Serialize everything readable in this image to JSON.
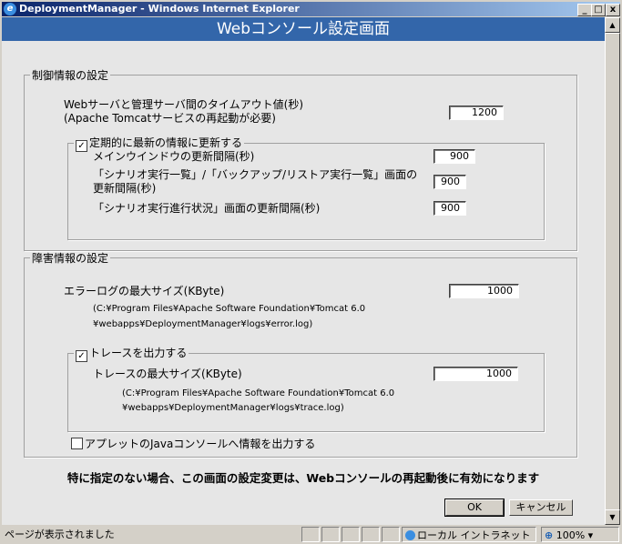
{
  "window": {
    "title": "DeploymentManager - Windows Internet Explorer",
    "ie_icon": "e",
    "minimize": "_",
    "maximize": "□",
    "close": "x"
  },
  "header": {
    "title": "Webコンソール設定画面"
  },
  "control": {
    "legend": "制御情報の設定",
    "timeout_label_1": "Webサーバと管理サーバ間のタイムアウト値(秒)",
    "timeout_label_2": "(Apache Tomcatサービスの再起動が必要)",
    "timeout_value": "1200",
    "refresh_checked": true,
    "refresh_label": "定期的に最新の情報に更新する",
    "main_window_label": "メインウインドウの更新間隔(秒)",
    "main_window_value": "900",
    "scenario_list_label_1": "「シナリオ実行一覧」/「バックアップ/リストア実行一覧」画面の",
    "scenario_list_label_2": "更新間隔(秒)",
    "scenario_list_value": "900",
    "scenario_progress_label": "「シナリオ実行進行状況」画面の更新間隔(秒)",
    "scenario_progress_value": "900"
  },
  "fault": {
    "legend": "障害情報の設定",
    "errorlog_label": "エラーログの最大サイズ(KByte)",
    "errorlog_value": "1000",
    "errorlog_path_1": "(C:¥Program Files¥Apache Software Foundation¥Tomcat 6.0",
    "errorlog_path_2": "¥webapps¥DeploymentManager¥logs¥error.log)",
    "trace_checked": true,
    "trace_label": "トレースを出力する",
    "trace_size_label": "トレースの最大サイズ(KByte)",
    "trace_size_value": "1000",
    "trace_path_1": "(C:¥Program Files¥Apache Software Foundation¥Tomcat 6.0",
    "trace_path_2": "¥webapps¥DeploymentManager¥logs¥trace.log)",
    "applet_checked": false,
    "applet_label": "アプレットのJavaコンソールへ情報を出力する"
  },
  "notice": "特に指定のない場合、この画面の設定変更は、Webコンソールの再起動後に有効になります",
  "buttons": {
    "ok": "OK",
    "cancel": "キャンセル"
  },
  "statusbar": {
    "status": "ページが表示されました",
    "zone": "ローカル イントラネット",
    "zoom": "100%",
    "zoom_arrow": "▾"
  },
  "icons": {
    "check": "✓",
    "scroll_up": "▲",
    "scroll_down": "▼",
    "magnifier": "⊕"
  }
}
